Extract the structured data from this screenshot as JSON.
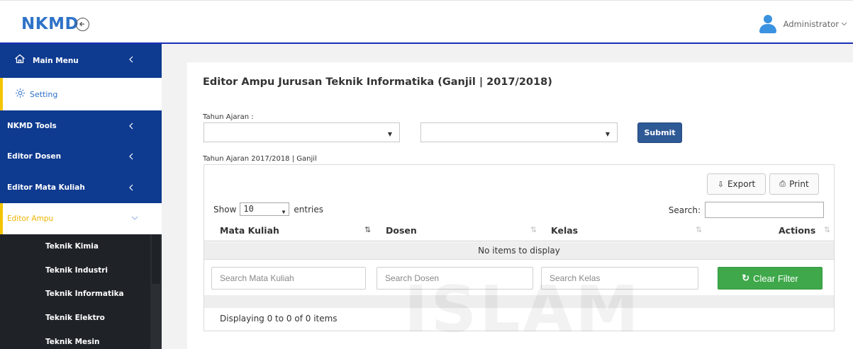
{
  "header": {
    "brand": "NKMD",
    "user_name": "Administrator"
  },
  "sidebar": {
    "items": [
      {
        "label": "Main Menu",
        "icon": "home-icon"
      },
      {
        "label": "Setting",
        "icon": "gear-icon"
      },
      {
        "label": "NKMD Tools"
      },
      {
        "label": "Editor Dosen"
      },
      {
        "label": "Editor Mata Kuliah"
      },
      {
        "label": "Editor Ampu"
      }
    ],
    "subitems": [
      "Teknik Kimia",
      "Teknik Industri",
      "Teknik Informatika",
      "Teknik Elektro",
      "Teknik Mesin"
    ]
  },
  "main": {
    "title": "Editor Ampu Jurusan Teknik Informatika (Ganjil | 2017/2018)",
    "tahun_label": "Tahun Ajaran :",
    "select1_value": "",
    "select2_value": "",
    "submit_label": "Submit",
    "info": "Tahun Ajaran 2017/2018 | Ganjil"
  },
  "grid": {
    "export_label": "Export",
    "print_label": "Print",
    "show_label": "Show",
    "entries_value": "10",
    "entries_label": "entries",
    "search_label": "Search:",
    "columns": [
      "Mata Kuliah",
      "Dosen",
      "Kelas",
      "Actions"
    ],
    "empty_message": "No items to display",
    "filters": {
      "mata_kuliah_placeholder": "Search Mata Kuliah",
      "dosen_placeholder": "Search Dosen",
      "kelas_placeholder": "Search Kelas"
    },
    "clear_filter_label": "Clear Filter",
    "footer": "Displaying 0 to 0 of 0 items"
  },
  "watermark": "ISLAM",
  "colors": {
    "brand": "#2f73c8",
    "sidebar": "#0e3a8f",
    "accent_yellow": "#f4c400",
    "submit": "#2e5a96",
    "clear_filter": "#3fa84a"
  }
}
